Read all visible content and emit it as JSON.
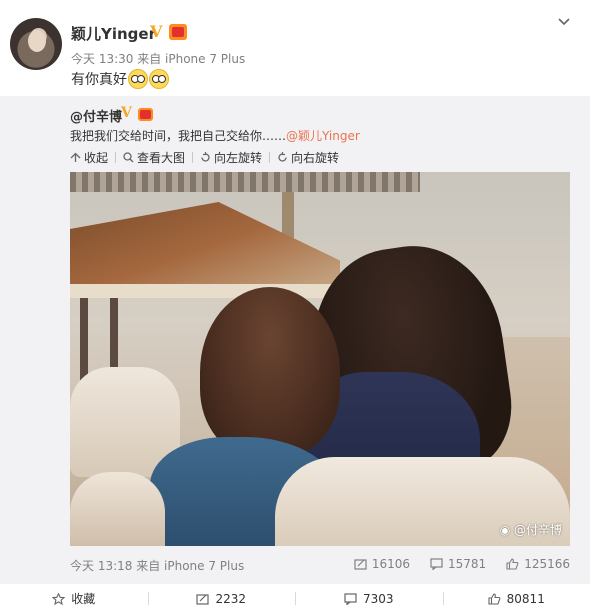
{
  "post": {
    "user_name": "颖儿Yinger",
    "verified_mark": "V",
    "meta": "今天 13:30 来自 iPhone 7 Plus",
    "text": "有你真好"
  },
  "repost": {
    "user_name": "@付辛博",
    "verified_mark": "V",
    "text": "我把我们交给时间，我把自己交给你……",
    "mention": "@颖儿Yinger",
    "actions": {
      "collect": "收起",
      "view_large": "查看大图",
      "rotate_left": "向左旋转",
      "rotate_right": "向右旋转"
    },
    "image_watermark": "@付辛博",
    "time_meta": "今天 13:18 来自 iPhone 7 Plus",
    "stats": {
      "reposts": "16106",
      "comments": "15781",
      "likes": "125166"
    }
  },
  "action_bar": {
    "favorite": "收藏",
    "repost": "2232",
    "comment": "7303",
    "like": "80811"
  },
  "colors": {
    "mention": "#eb7350",
    "verify": "#f5a623",
    "repost_bg": "#f2f2f5",
    "meta": "#808080"
  },
  "icons": [
    "chevron-down-icon",
    "collapse-icon",
    "zoom-icon",
    "rotate-left-icon",
    "rotate-right-icon",
    "repost-icon",
    "comment-icon",
    "like-icon",
    "star-icon",
    "weibo-logo-icon"
  ]
}
